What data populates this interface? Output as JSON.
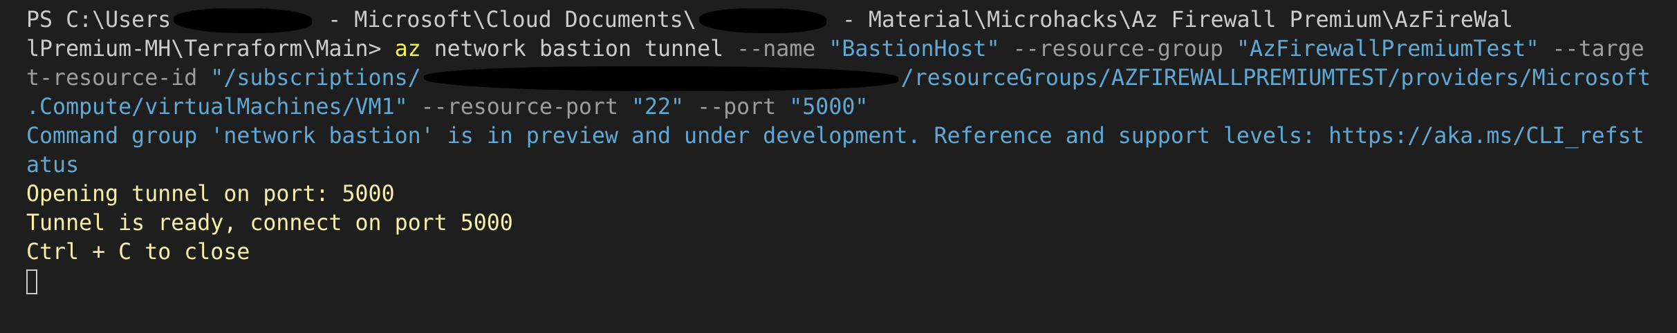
{
  "terminal": {
    "line1": {
      "prefix": "PS C:\\Users",
      "mid": " - Microsoft\\Cloud Documents\\",
      "suffix": " - Material\\Microhacks\\Az Firewall Premium\\AzFireWal"
    },
    "line2": {
      "prompt": "lPremium-MH\\Terraform\\Main> ",
      "cmd": "az",
      "args": " network bastion tunnel ",
      "p_name": "--name ",
      "v_name": "\"BastionHost\"",
      "p_rg": " --resource-group ",
      "v_rg": "\"AzFirewallPremiumTest\"",
      "p_target": " --targe"
    },
    "line3": {
      "p_target": "t-resource-id ",
      "v_start": "\"/subscriptions/",
      "v_end": "/resourceGroups/AZFIREWALLPREMIUMTEST/providers/Microsoft"
    },
    "line4": {
      "v": ".Compute/virtualMachines/VM1\"",
      "p_rport": " --resource-port ",
      "v_rport": "\"22\"",
      "p_port": " --port ",
      "v_port": "\"5000\""
    },
    "warning1": "Command group 'network bastion' is in preview and under development. Reference and support levels: https://aka.ms/CLI_refst",
    "warning2": "atus",
    "out1": "Opening tunnel on port: 5000",
    "out2": "Tunnel is ready, connect on port 5000",
    "out3": "Ctrl + C to close"
  },
  "colors": {
    "background": "#1e1e1e",
    "text": "#cccccc",
    "param": "#9d9d9d",
    "string": "#5ea9d6",
    "command": "#f5f543",
    "output": "#f9f1a5"
  }
}
